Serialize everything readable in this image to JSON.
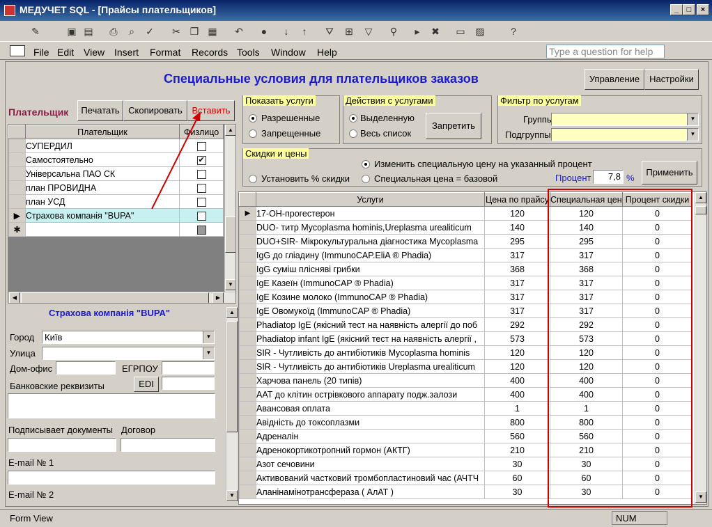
{
  "window": {
    "title": "МЕДУЧЕТ SQL - [Прайсы плательщиков]"
  },
  "menu": [
    "File",
    "Edit",
    "View",
    "Insert",
    "Format",
    "Records",
    "Tools",
    "Window",
    "Help"
  ],
  "help_placeholder": "Type a question for help",
  "form": {
    "title": "Специальные условия для плательщиков заказов",
    "btn_manage": "Управление",
    "btn_settings": "Настройки",
    "payer_label": "Плательщик",
    "btn_print": "Печатать",
    "btn_copy": "Скопировать",
    "btn_paste": "Вставить",
    "payer_headers": [
      "Плательщик",
      "Физлицо"
    ],
    "payers": [
      {
        "name": "СУПЕРДИЛ",
        "phys": ""
      },
      {
        "name": "Самостоятельно",
        "phys": "✔"
      },
      {
        "name": "Універсальна ПАО СК",
        "phys": ""
      },
      {
        "name": "план ПРОВИДНА",
        "phys": ""
      },
      {
        "name": "план УСД",
        "phys": ""
      },
      {
        "name": "Страхова компанія \"BUPA\"",
        "phys": ""
      }
    ],
    "selected_payer": "Страхова компанія \"BUPA\"",
    "city_label": "Город",
    "city": "Київ",
    "street_label": "Улица",
    "office_label": "Дом-офис",
    "egrpou_label": "ЕГРПОУ",
    "bank_label": "Банковские реквизиты",
    "edi": "EDI",
    "signs_label": "Подписывает документы",
    "contract_label": "Договор",
    "email1_label": "E-mail № 1",
    "email2_label": "E-mail № 2",
    "show_title": "Показать услуги",
    "show_allowed": "Разрешенные",
    "show_forbidden": "Запрещенные",
    "act_title": "Действия с услугами",
    "act_selected": "Выделенную",
    "act_all": "Весь список",
    "btn_forbid": "Запретить",
    "filter_title": "Фильтр по услугам",
    "groups_label": "Группы",
    "subgroups_label": "Подгруппы",
    "disc_title": "Скидки и цены",
    "disc_percent": "Установить % скидки",
    "disc_change": "Изменить специальную цену на указанный процент",
    "disc_base": "Специальная цена = базовой",
    "percent_label": "Процент",
    "percent_value": "7,8",
    "percent_sign": "%",
    "btn_apply": "Применить",
    "svc_headers": [
      "Услуги",
      "Цена по прайсу",
      "Специальная цена",
      "Процент скидки"
    ],
    "services": [
      [
        "17-ОН-прогестерон",
        "120",
        "120",
        "0"
      ],
      [
        "DUO- титр  Mycoplasma hominis,Ureplasma urealiticum",
        "140",
        "140",
        "0"
      ],
      [
        "DUO+SIR- Мікрокультуральна діагностика Mycoplasma",
        "295",
        "295",
        "0"
      ],
      [
        "IgG до гліадину (ImmunoCAP.EliA ® Phadia)",
        "317",
        "317",
        "0"
      ],
      [
        "IgG суміш пліснявi грибки",
        "368",
        "368",
        "0"
      ],
      [
        "IgE Казеїн (ImmunoCAP ® Phadia)",
        "317",
        "317",
        "0"
      ],
      [
        "IgE Козине молоко  (ImmunoCAP ® Phadia)",
        "317",
        "317",
        "0"
      ],
      [
        "IgE Овомукоїд (ImmunoCAP ® Phadia)",
        "317",
        "317",
        "0"
      ],
      [
        "Phadiatop IgE (якісний тест на наявність алергії до поб",
        "292",
        "292",
        "0"
      ],
      [
        "Phadiatop infant IgE (якісний тест на наявність алергії ,",
        "573",
        "573",
        "0"
      ],
      [
        "SIR - Чутливість до антибіотиків Mycoplasma hominis",
        "120",
        "120",
        "0"
      ],
      [
        "SIR - Чутливість до антибіотиків Ureplasma urealiticum",
        "120",
        "120",
        "0"
      ],
      [
        "Харчова панель (20 типів)",
        "400",
        "400",
        "0"
      ],
      [
        "ААТ до клітин острівкового аппарату подж.залози",
        "400",
        "400",
        "0"
      ],
      [
        "Авансовая оплата",
        "1",
        "1",
        "0"
      ],
      [
        "Авідність до токсоплазми",
        "800",
        "800",
        "0"
      ],
      [
        "Адреналін",
        "560",
        "560",
        "0"
      ],
      [
        "Адренокортикотропний гормон (АКТГ)",
        "210",
        "210",
        "0"
      ],
      [
        "Азот сечовини",
        "30",
        "30",
        "0"
      ],
      [
        "Активований частковий тромбопластиновий час (АЧТЧ",
        "60",
        "60",
        "0"
      ],
      [
        "Аланінамінотрансфераза ( АлАТ )",
        "30",
        "30",
        "0"
      ]
    ]
  },
  "status": {
    "left": "Form View",
    "num": "NUM"
  }
}
